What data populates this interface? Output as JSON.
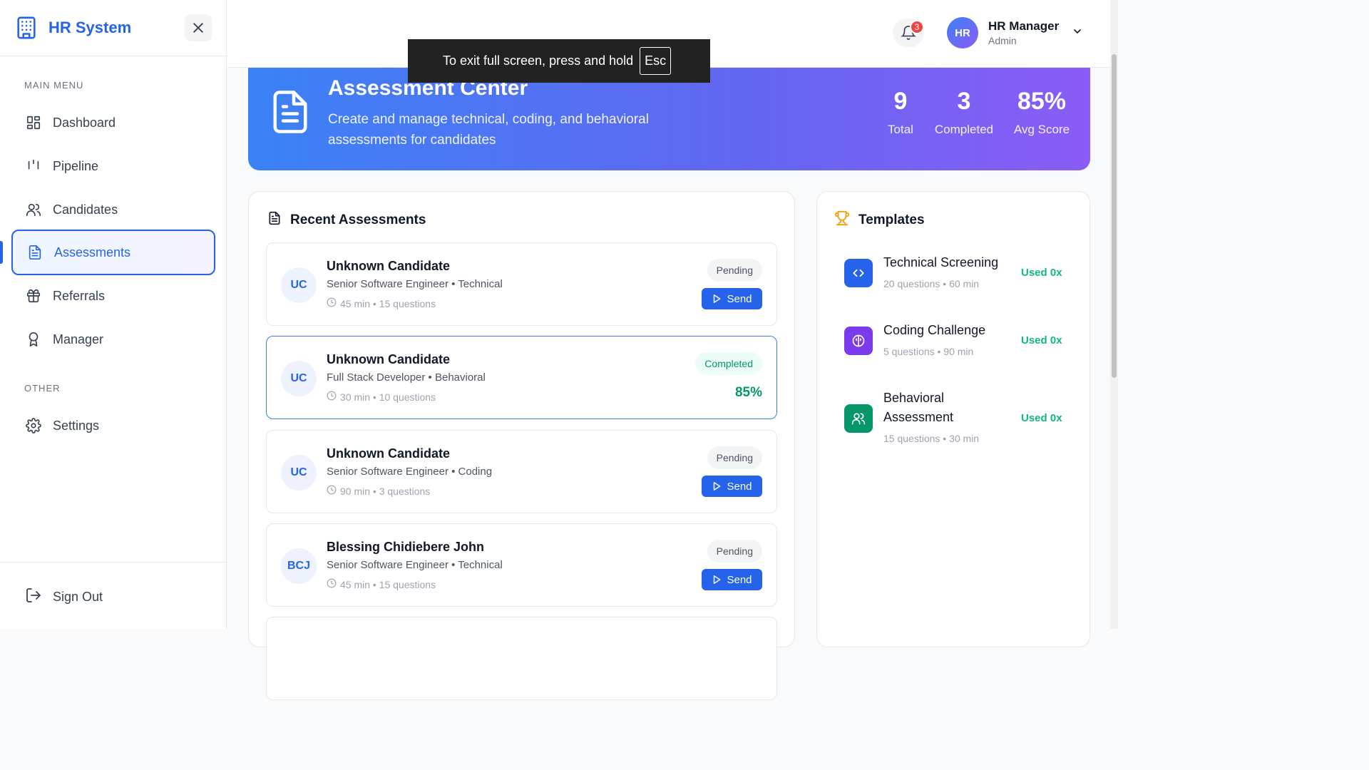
{
  "sidebar": {
    "brand": "HR System",
    "main_menu_label": "MAIN MENU",
    "other_label": "OTHER",
    "items": [
      {
        "label": "Dashboard",
        "icon": "dashboard-icon"
      },
      {
        "label": "Pipeline",
        "icon": "pipeline-icon"
      },
      {
        "label": "Candidates",
        "icon": "users-icon"
      },
      {
        "label": "Assessments",
        "icon": "document-icon",
        "active": true
      },
      {
        "label": "Referrals",
        "icon": "gift-icon"
      },
      {
        "label": "Manager",
        "icon": "award-icon"
      }
    ],
    "other_items": [
      {
        "label": "Settings",
        "icon": "gear-icon"
      }
    ],
    "sign_out": "Sign Out"
  },
  "header": {
    "notifications_count": "3",
    "user": {
      "initials": "HR",
      "name": "HR Manager",
      "role": "Admin"
    }
  },
  "fullscreen_toast": {
    "text": "To exit full screen, press and hold",
    "key": "Esc"
  },
  "banner": {
    "title": "Assessment Center",
    "subtitle": "Create and manage technical, coding, and behavioral assessments for candidates",
    "stats": [
      {
        "value": "9",
        "label": "Total"
      },
      {
        "value": "3",
        "label": "Completed"
      },
      {
        "value": "85%",
        "label": "Avg Score"
      }
    ]
  },
  "recent": {
    "title": "Recent Assessments",
    "items": [
      {
        "initials": "UC",
        "name": "Unknown Candidate",
        "role": "Senior Software Engineer • Technical",
        "meta": "45 min • 15 questions",
        "status": "Pending",
        "action": "Send"
      },
      {
        "initials": "UC",
        "name": "Unknown Candidate",
        "role": "Full Stack Developer • Behavioral",
        "meta": "30 min • 10 questions",
        "status": "Completed",
        "score": "85%"
      },
      {
        "initials": "UC",
        "name": "Unknown Candidate",
        "role": "Senior Software Engineer • Coding",
        "meta": "90 min • 3 questions",
        "status": "Pending",
        "action": "Send"
      },
      {
        "initials": "BCJ",
        "name": "Blessing Chidiebere John",
        "role": "Senior Software Engineer • Technical",
        "meta": "45 min • 15 questions",
        "status": "Pending",
        "action": "Send"
      }
    ]
  },
  "templates": {
    "title": "Templates",
    "items": [
      {
        "name": "Technical Screening",
        "meta": "20 questions • 60 min",
        "used": "Used 0x",
        "color": "#2563eb",
        "icon": "code-icon"
      },
      {
        "name": "Coding Challenge",
        "meta": "5 questions • 90 min",
        "used": "Used 0x",
        "color": "#7c3aed",
        "icon": "brain-icon"
      },
      {
        "name": "Behavioral Assessment",
        "meta": "15 questions • 30 min",
        "used": "Used 0x",
        "color": "#059669",
        "icon": "users-icon"
      }
    ]
  }
}
